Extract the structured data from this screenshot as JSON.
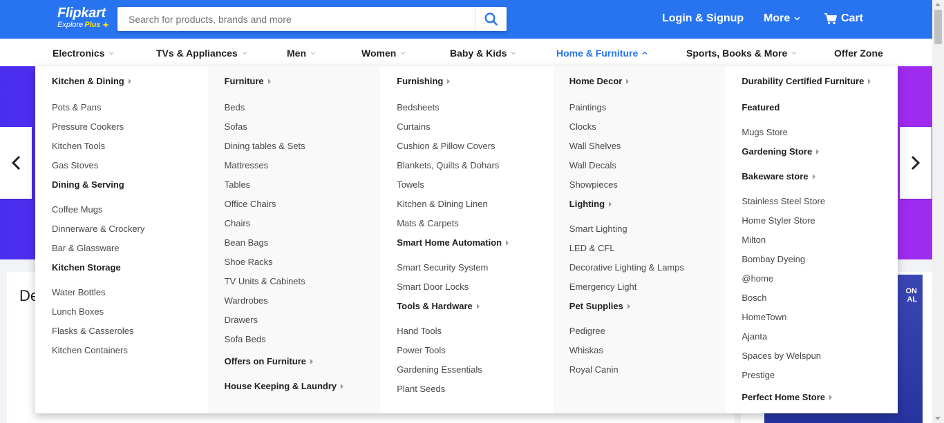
{
  "header": {
    "logo_text": "Flipkart",
    "logo_sub": "Explore",
    "logo_plus": "Plus",
    "search_placeholder": "Search for products, brands and more",
    "login_label": "Login & Signup",
    "more_label": "More",
    "cart_label": "Cart"
  },
  "colors": {
    "brand_blue": "#2874f0",
    "plus_yellow": "#ffe500"
  },
  "categories": [
    {
      "label": "Electronics",
      "active": false
    },
    {
      "label": "TVs & Appliances",
      "active": false
    },
    {
      "label": "Men",
      "active": false
    },
    {
      "label": "Women",
      "active": false
    },
    {
      "label": "Baby & Kids",
      "active": false
    },
    {
      "label": "Home & Furniture",
      "active": true
    },
    {
      "label": "Sports, Books & More",
      "active": false
    },
    {
      "label": "Offer Zone",
      "active": false
    }
  ],
  "page": {
    "deals_title_partial": "De"
  },
  "side_card": {
    "line1": "ON",
    "line2": "AL"
  },
  "menu": {
    "col1": {
      "h1": "Kitchen & Dining",
      "i1": "Pots & Pans",
      "i2": "Pressure Cookers",
      "i3": "Kitchen Tools",
      "i4": "Gas Stoves",
      "h2": "Dining & Serving",
      "i5": "Coffee Mugs",
      "i6": "Dinnerware & Crockery",
      "i7": "Bar & Glassware",
      "h3": "Kitchen Storage",
      "i8": "Water Bottles",
      "i9": "Lunch Boxes",
      "i10": "Flasks & Casseroles",
      "i11": "Kitchen Containers"
    },
    "col2": {
      "h1": "Furniture",
      "i1": "Beds",
      "i2": "Sofas",
      "i3": "Dining tables & Sets",
      "i4": "Mattresses",
      "i5": "Tables",
      "i6": "Office Chairs",
      "i7": "Chairs",
      "i8": "Bean Bags",
      "i9": "Shoe Racks",
      "i10": "TV Units & Cabinets",
      "i11": "Wardrobes",
      "i12": "Drawers",
      "i13": "Sofa Beds",
      "h2": "Offers on Furniture",
      "h3": "House Keeping & Laundry"
    },
    "col3": {
      "h1": "Furnishing",
      "i1": "Bedsheets",
      "i2": "Curtains",
      "i3": "Cushion & Pillow Covers",
      "i4": "Blankets, Quilts & Dohars",
      "i5": "Towels",
      "i6": "Kitchen & Dining Linen",
      "i7": "Mats & Carpets",
      "h2": "Smart Home Automation",
      "i8": "Smart Security System",
      "i9": "Smart Door Locks",
      "h3": "Tools & Hardware",
      "i10": "Hand Tools",
      "i11": "Power Tools",
      "i12": "Gardening Essentials",
      "i13": "Plant Seeds"
    },
    "col4": {
      "h1": "Home Decor",
      "i1": "Paintings",
      "i2": "Clocks",
      "i3": "Wall Shelves",
      "i4": "Wall Decals",
      "i5": "Showpieces",
      "h2": "Lighting",
      "i6": "Smart Lighting",
      "i7": "LED & CFL",
      "i8": "Decorative Lighting & Lamps",
      "i9": "Emergency Light",
      "h3": "Pet Supplies",
      "i10": "Pedigree",
      "i11": "Whiskas",
      "i12": "Royal Canin"
    },
    "col5": {
      "h1": "Durability Certified Furniture",
      "h2": "Featured",
      "i1": "Mugs Store",
      "h3": "Gardening Store",
      "h4": "Bakeware store",
      "i2": "Stainless Steel Store",
      "i3": "Home Styler Store",
      "i4": "Milton",
      "i5": "Bombay Dyeing",
      "i6": "@home",
      "i7": "Bosch",
      "i8": "HomeTown",
      "i9": "Ajanta",
      "i10": "Spaces by Welspun",
      "i11": "Prestige",
      "h5": "Perfect Home Store"
    }
  }
}
